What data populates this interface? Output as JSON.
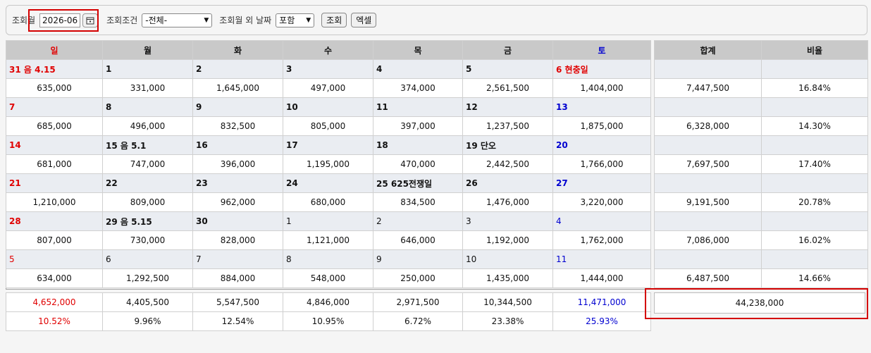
{
  "filter": {
    "month_label": "조회월",
    "month_value": "2026-06",
    "condition_label": "조회조건",
    "condition_value": "-전체-",
    "other_dates_label": "조회월 외 날짜",
    "other_dates_value": "포함",
    "search_btn": "조회",
    "excel_btn": "엑셀"
  },
  "colors": {
    "sunday": "#e00000",
    "saturday": "#0000d0",
    "highlight": "#d40000"
  },
  "calendar": {
    "headers": [
      "일",
      "월",
      "화",
      "수",
      "목",
      "금",
      "토"
    ],
    "weeks": [
      {
        "days": [
          "31 음 4.15",
          "1",
          "2",
          "3",
          "4",
          "5",
          "6 현충일"
        ],
        "values": [
          "635,000",
          "331,000",
          "1,645,000",
          "497,000",
          "374,000",
          "2,561,500",
          "1,404,000"
        ],
        "total": "7,447,500",
        "ratio": "16.84%"
      },
      {
        "days": [
          "7",
          "8",
          "9",
          "10",
          "11",
          "12",
          "13"
        ],
        "values": [
          "685,000",
          "496,000",
          "832,500",
          "805,000",
          "397,000",
          "1,237,500",
          "1,875,000"
        ],
        "total": "6,328,000",
        "ratio": "14.30%"
      },
      {
        "days": [
          "14",
          "15 음 5.1",
          "16",
          "17",
          "18",
          "19 단오",
          "20"
        ],
        "values": [
          "681,000",
          "747,000",
          "396,000",
          "1,195,000",
          "470,000",
          "2,442,500",
          "1,766,000"
        ],
        "total": "7,697,500",
        "ratio": "17.40%"
      },
      {
        "days": [
          "21",
          "22",
          "23",
          "24",
          "25 625전쟁일",
          "26",
          "27"
        ],
        "values": [
          "1,210,000",
          "809,000",
          "962,000",
          "680,000",
          "834,500",
          "1,476,000",
          "3,220,000"
        ],
        "total": "9,191,500",
        "ratio": "20.78%"
      },
      {
        "days": [
          "28",
          "29 음 5.15",
          "30",
          "1",
          "2",
          "3",
          "4"
        ],
        "values": [
          "807,000",
          "730,000",
          "828,000",
          "1,121,000",
          "646,000",
          "1,192,000",
          "1,762,000"
        ],
        "total": "7,086,000",
        "ratio": "16.02%"
      },
      {
        "days": [
          "5",
          "6",
          "7",
          "8",
          "9",
          "10",
          "11"
        ],
        "values": [
          "634,000",
          "1,292,500",
          "884,000",
          "548,000",
          "250,000",
          "1,435,000",
          "1,444,000"
        ],
        "total": "6,487,500",
        "ratio": "14.66%"
      }
    ]
  },
  "summary": {
    "headers": [
      "합계",
      "비율"
    ]
  },
  "totals": {
    "values": [
      "4,652,000",
      "4,405,500",
      "5,547,500",
      "4,846,000",
      "2,971,500",
      "10,344,500",
      "11,471,000"
    ],
    "ratios": [
      "10.52%",
      "9.96%",
      "12.54%",
      "10.95%",
      "6.72%",
      "23.38%",
      "25.93%"
    ],
    "grand_total": "44,238,000"
  }
}
